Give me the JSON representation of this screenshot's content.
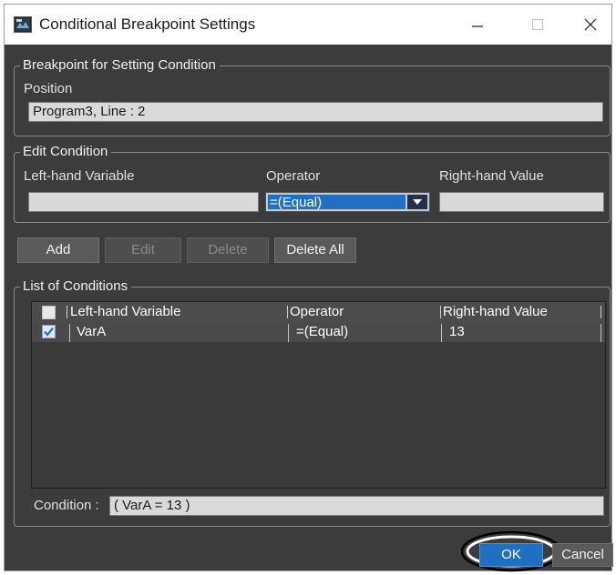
{
  "window": {
    "title": "Conditional Breakpoint Settings",
    "icon": "app-window-icon",
    "controls": {
      "minimize": "minimize-icon",
      "maximize": "maximize-icon",
      "close": "close-icon"
    }
  },
  "breakpoint_group": {
    "legend": "Breakpoint for Setting Condition",
    "position_label": "Position",
    "position_value": "Program3, Line : 2"
  },
  "edit_group": {
    "legend": "Edit Condition",
    "left_label": "Left-hand Variable",
    "operator_label": "Operator",
    "right_label": "Right-hand Value",
    "left_value": "",
    "operator_value": "=(Equal)",
    "right_value": ""
  },
  "actions": {
    "add": "Add",
    "edit": "Edit",
    "delete": "Delete",
    "delete_all": "Delete All"
  },
  "conditions_group": {
    "legend": "List of Conditions",
    "columns": [
      "Left-hand Variable",
      "Operator",
      "Right-hand Value"
    ],
    "rows": [
      {
        "checked": true,
        "left": "VarA",
        "operator": "=(Equal)",
        "right": "13"
      }
    ],
    "condition_label": "Condition :",
    "condition_value": "( VarA = 13 )"
  },
  "footer": {
    "ok": "OK",
    "cancel": "Cancel"
  },
  "colors": {
    "dialog_bg": "#3c3c3c",
    "accent": "#1f6fc2",
    "textbox_bg": "#d9d9d9"
  }
}
